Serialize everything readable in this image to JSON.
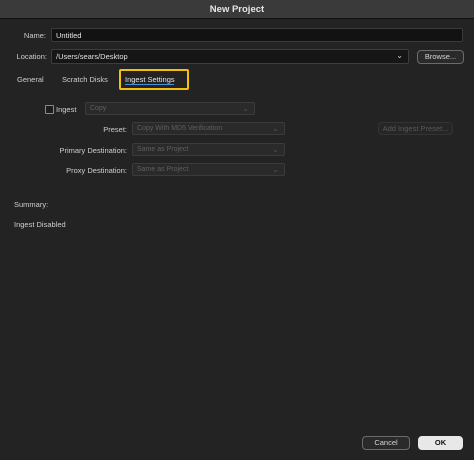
{
  "window": {
    "title": "New Project"
  },
  "name": {
    "label": "Name:",
    "value": "Untitled"
  },
  "location": {
    "label": "Location:",
    "value": "/Users/sears/Desktop",
    "browse_label": "Browse..."
  },
  "tabs": [
    {
      "label": "General"
    },
    {
      "label": "Scratch Disks"
    },
    {
      "label": "Ingest Settings",
      "active": true
    }
  ],
  "ingest": {
    "checkbox_label": "Ingest",
    "checked": false,
    "mode_value": "Copy",
    "preset_label": "Preset:",
    "preset_value": "Copy With MD5 Verification",
    "add_preset_label": "Add Ingest Preset...",
    "primary_label": "Primary Destination:",
    "primary_value": "Same as Project",
    "proxy_label": "Proxy Destination:",
    "proxy_value": "Same as Project"
  },
  "summary": {
    "label": "Summary:",
    "text": "Ingest Disabled"
  },
  "footer": {
    "cancel_label": "Cancel",
    "ok_label": "OK"
  },
  "colors": {
    "highlight": "#f2c20f",
    "tab_underline": "#4a90e2"
  }
}
